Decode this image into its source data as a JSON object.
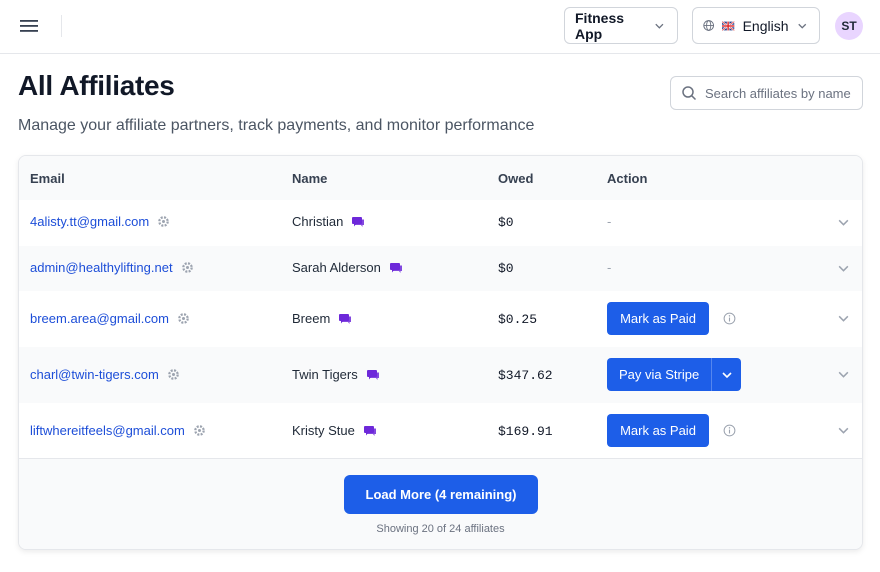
{
  "header": {
    "app_selector": "Fitness App",
    "language_selector": "English",
    "avatar_initials": "ST"
  },
  "page": {
    "title": "All Affiliates",
    "subtitle": "Manage your affiliate partners, track payments, and monitor performance"
  },
  "search": {
    "placeholder": "Search affiliates by name"
  },
  "table": {
    "columns": [
      "Email",
      "Name",
      "Owed",
      "Action"
    ],
    "rows": [
      {
        "email": "4alisty.tt@gmail.com",
        "name": "Christian",
        "owed": "$0",
        "action": "-"
      },
      {
        "email": "admin@healthylifting.net",
        "name": "Sarah Alderson",
        "owed": "$0",
        "action": "-"
      },
      {
        "email": "breem.area@gmail.com",
        "name": "Breem",
        "owed": "$0.25",
        "action": "Mark as Paid"
      },
      {
        "email": "charl@twin-tigers.com",
        "name": "Twin Tigers",
        "owed": "$347.62",
        "action": "Pay via Stripe"
      },
      {
        "email": "liftwhereitfeels@gmail.com",
        "name": "Kristy Stue",
        "owed": "$169.91",
        "action": "Mark as Paid"
      }
    ]
  },
  "footer": {
    "load_more": "Load More (4 remaining)",
    "showing": "Showing 20 of 24 affiliates"
  },
  "colors": {
    "primary": "#1d5ee8",
    "link": "#1d4ed8",
    "discord": "#6d28d9",
    "avatar_bg": "#e9d5ff"
  },
  "icons": [
    "menu-icon",
    "chevron-down-icon",
    "globe-icon",
    "uk-flag-icon",
    "search-icon",
    "gear-icon",
    "discord-icon",
    "info-icon"
  ]
}
